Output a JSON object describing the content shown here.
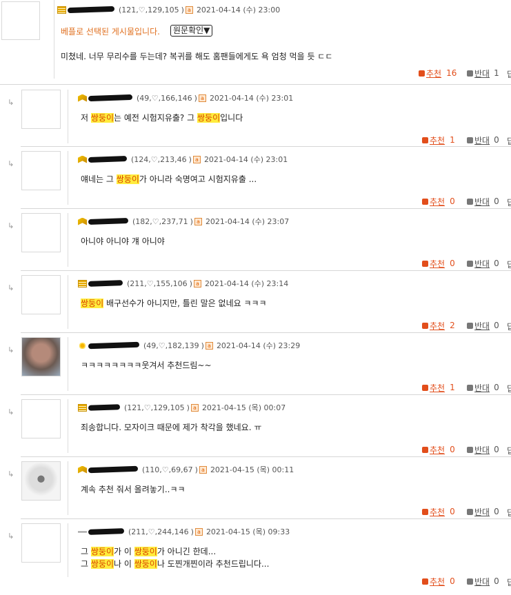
{
  "buttons": {
    "recommend": "추천",
    "oppose": "반대",
    "original_check": "원문확인▼",
    "more": "답"
  },
  "icons": {
    "ip_badge": "a"
  },
  "main_comment": {
    "stats": "121,♡,129,105",
    "date": "2021-04-14 (수) 23:00",
    "notice": "베플로 선택된 게시물입니다.",
    "text": "미쳤네. 너무 무리수를 두는데? 복귀를 해도 홈팬들에게도 욕 엄청 먹을 듯 ㄷㄷ",
    "recommend_count": "16",
    "oppose_count": "1"
  },
  "replies": [
    {
      "stats": "49,♡,166,146",
      "date": "2021-04-14 (수) 23:01",
      "text": [
        "저 ",
        "쌍둥이",
        "는 예전 시험지유출? 그 ",
        "쌍둥이",
        "입니다"
      ],
      "recommend_count": "1",
      "oppose_count": "0"
    },
    {
      "stats": "124,♡,213,46",
      "date": "2021-04-14 (수) 23:01",
      "text": [
        "얘네는 그 ",
        "쌍둥이",
        "가 아니라 숙명여고 시험지유출 ..."
      ],
      "recommend_count": "0",
      "oppose_count": "0"
    },
    {
      "stats": "182,♡,237,71",
      "date": "2021-04-14 (수) 23:07",
      "text": [
        "아니야 아니야 걔 아니야"
      ],
      "recommend_count": "0",
      "oppose_count": "0"
    },
    {
      "stats": "211,♡,155,106",
      "date": "2021-04-14 (수) 23:14",
      "text": [
        "",
        "쌍둥이",
        " 배구선수가 아니지만, 틀린 말은 없네요 ㅋㅋㅋ"
      ],
      "recommend_count": "2",
      "oppose_count": "0"
    },
    {
      "stats": "49,♡,182,139",
      "date": "2021-04-14 (수) 23:29",
      "text": [
        "ㅋㅋㅋㅋㅋㅋㅋㅋ웃겨서 추천드림~~"
      ],
      "recommend_count": "1",
      "oppose_count": "0"
    },
    {
      "stats": "121,♡,129,105",
      "date": "2021-04-15 (목) 00:07",
      "text": [
        "죄송합니다. 모자이크 때문에 제가 착각을 했네요. ㅠ"
      ],
      "recommend_count": "0",
      "oppose_count": "0"
    },
    {
      "stats": "110,♡,69,67",
      "date": "2021-04-15 (목) 00:11",
      "text": [
        "계속 추천 줘서 올려놓기..ㅋㅋ"
      ],
      "recommend_count": "0",
      "oppose_count": "0"
    },
    {
      "stats": "211,♡,244,146",
      "date": "2021-04-15 (목) 09:33",
      "text": [
        "그 ",
        "쌍둥이",
        "가 이 ",
        "쌍둥이",
        "가 아니긴 한데..."
      ],
      "text2": [
        "그 ",
        "쌍둥이",
        "나 이 ",
        "쌍둥이",
        "나 도찐개찐이라 추천드립니다..."
      ],
      "recommend_count": "0",
      "oppose_count": "0"
    }
  ]
}
